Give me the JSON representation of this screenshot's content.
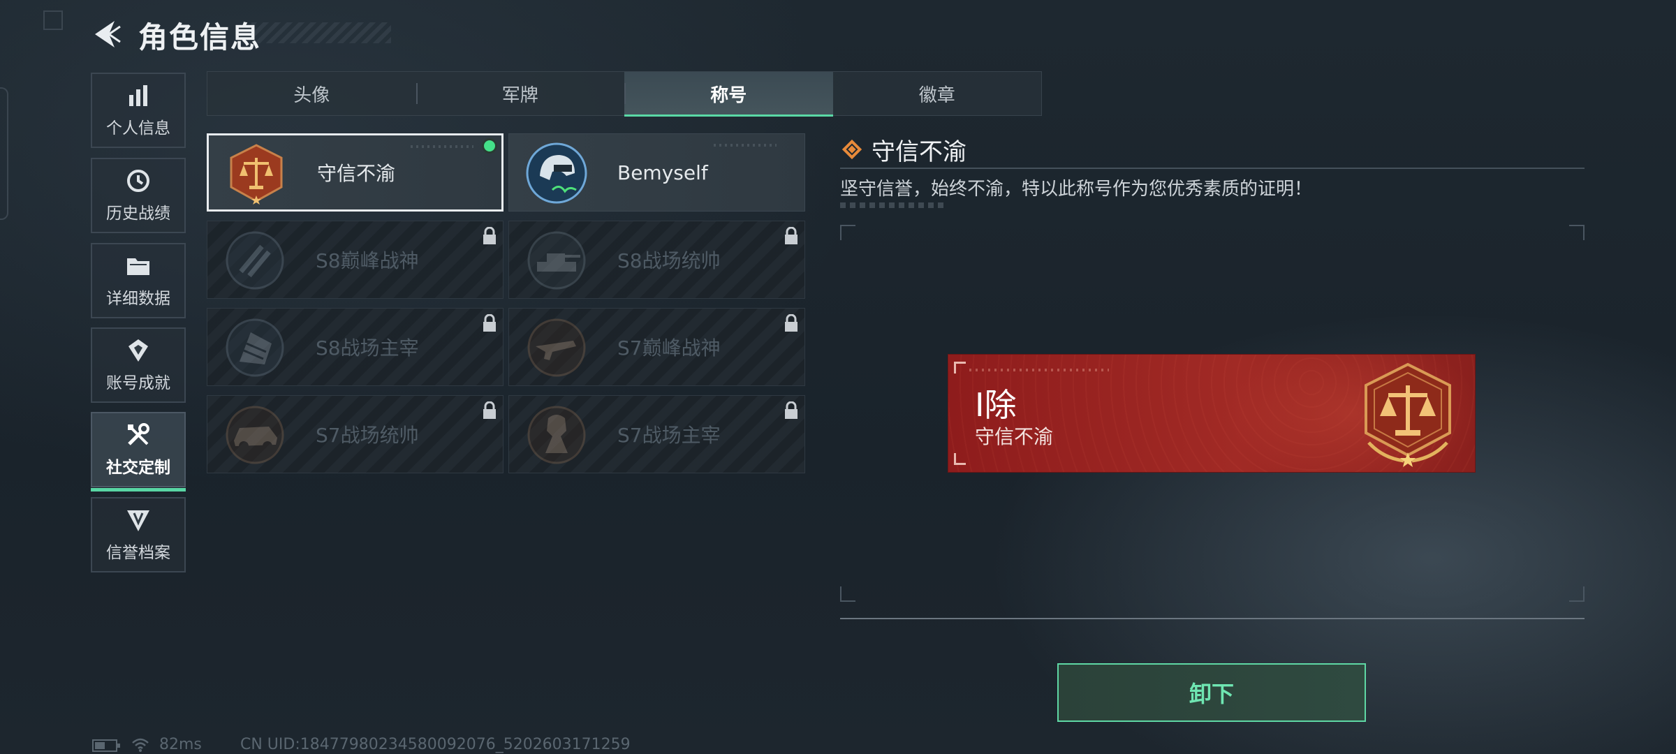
{
  "header": {
    "title": "角色信息",
    "back_icon": "back-arrow-icon"
  },
  "sidebar": {
    "items": [
      {
        "label": "个人信息",
        "icon": "bar-chart-icon",
        "active": false
      },
      {
        "label": "历史战绩",
        "icon": "history-clock-icon",
        "active": false
      },
      {
        "label": "详细数据",
        "icon": "folder-icon",
        "active": false
      },
      {
        "label": "账号成就",
        "icon": "achievement-icon",
        "active": false
      },
      {
        "label": "社交定制",
        "icon": "tools-icon",
        "active": true
      },
      {
        "label": "信誉档案",
        "icon": "reputation-icon",
        "active": false
      }
    ]
  },
  "tabs": [
    {
      "label": "头像",
      "active": false
    },
    {
      "label": "军牌",
      "active": false
    },
    {
      "label": "称号",
      "active": true
    },
    {
      "label": "徽章",
      "active": false
    }
  ],
  "titles": [
    {
      "name": "守信不渝",
      "state": "selected"
    },
    {
      "name": "Bemyself",
      "state": "unlocked"
    },
    {
      "name": "S8巅峰战神",
      "state": "locked"
    },
    {
      "name": "S8战场统帅",
      "state": "locked"
    },
    {
      "name": "S8战场主宰",
      "state": "locked"
    },
    {
      "name": "S7巅峰战神",
      "state": "locked"
    },
    {
      "name": "S7战场统帅",
      "state": "locked"
    },
    {
      "name": "S7战场主宰",
      "state": "locked"
    }
  ],
  "detail": {
    "title": "守信不渝",
    "description": "坚守信誉，始终不渝，特以此称号作为您优秀素质的证明！",
    "banner_name": "I除",
    "banner_title": "守信不渝",
    "unequip_label": "卸下",
    "accent": "#5ad9a6",
    "banner_color": "#a12a25"
  },
  "status": {
    "ping": "82ms",
    "uid": "CN UID:18477980234580092076_5202603171259"
  }
}
